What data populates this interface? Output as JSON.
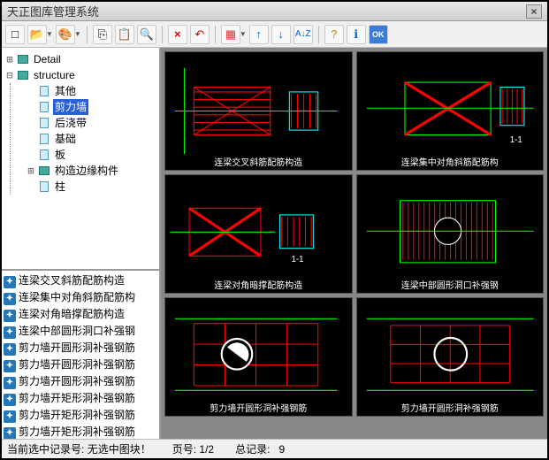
{
  "titlebar": {
    "title": "天正图库管理系统",
    "close": "×"
  },
  "toolbar": {
    "new": "□",
    "open": "📂",
    "palette": "🎨",
    "copy": "⎘",
    "paste": "📋",
    "view": "🔍",
    "delete": "×",
    "back": "↶",
    "grid": "▦",
    "up": "↑",
    "down": "↓",
    "sort": "A↓Z",
    "help": "?",
    "info": "ℹ",
    "ok": "OK"
  },
  "tree": {
    "root1": {
      "label": "Detail",
      "expanded": false
    },
    "root2": {
      "label": "structure",
      "expanded": true,
      "children": [
        {
          "label": "其他",
          "leaf": true
        },
        {
          "label": "剪力墙",
          "leaf": true,
          "selected": true
        },
        {
          "label": "后浇带",
          "leaf": true
        },
        {
          "label": "基础",
          "leaf": true
        },
        {
          "label": "板",
          "leaf": true
        },
        {
          "label": "构造边缘构件",
          "leaf": false
        },
        {
          "label": "柱",
          "leaf": true
        }
      ]
    }
  },
  "list": [
    "连梁交叉斜筋配筋构造",
    "连梁集中对角斜筋配筋构",
    "连梁对角暗撑配筋构造",
    "连梁中部圆形洞口补强钢",
    "剪力墙开圆形洞补强钢筋",
    "剪力墙开圆形洞补强钢筋",
    "剪力墙开圆形洞补强钢筋",
    "剪力墙开矩形洞补强钢筋",
    "剪力墙开矩形洞补强钢筋",
    "剪力墙开矩形洞补强钢筋"
  ],
  "thumbs": [
    {
      "caption": "连梁交叉斜筋配筋构造",
      "type": "cross"
    },
    {
      "caption": "连梁集中对角斜筋配筋构",
      "type": "xbox"
    },
    {
      "caption": "连梁对角暗撑配筋构造",
      "type": "cross2"
    },
    {
      "caption": "连梁中部圆形洞口补强钢",
      "type": "circle-hatch"
    },
    {
      "caption": "剪力墙开圆形洞补强钢筋",
      "type": "grid-circle"
    },
    {
      "caption": "剪力墙开圆形洞补强钢筋",
      "type": "grid-circle2"
    }
  ],
  "status": {
    "selection_label": "当前选中记录号:",
    "selection_value": "无选中图块！",
    "page_label": "页号:",
    "page_value": "1/2",
    "total_label": "总记录:",
    "total_value": "9"
  }
}
